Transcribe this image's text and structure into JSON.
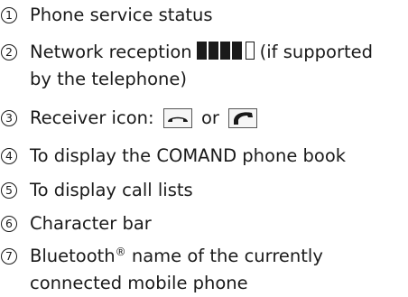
{
  "legend": {
    "items": [
      {
        "number": "1",
        "text": "Phone service status"
      },
      {
        "number": "2",
        "text_before": "Network reception",
        "text_after": "(if supported",
        "text_line2": "by the telephone)"
      },
      {
        "number": "3",
        "text_before": "Receiver icon:",
        "text_mid": "or"
      },
      {
        "number": "4",
        "text": "To display the COMAND phone book"
      },
      {
        "number": "5",
        "text": "To display call lists"
      },
      {
        "number": "6",
        "text": "Character bar"
      },
      {
        "number": "7",
        "text_before": "Bluetooth",
        "superscript": "®",
        "text_after": "name of the currently",
        "text_line2": "connected mobile phone"
      }
    ],
    "signal_bars": {
      "filled": 4,
      "total": 5
    },
    "icons": [
      "receiver-hung-up-icon",
      "receiver-lifted-icon"
    ]
  }
}
